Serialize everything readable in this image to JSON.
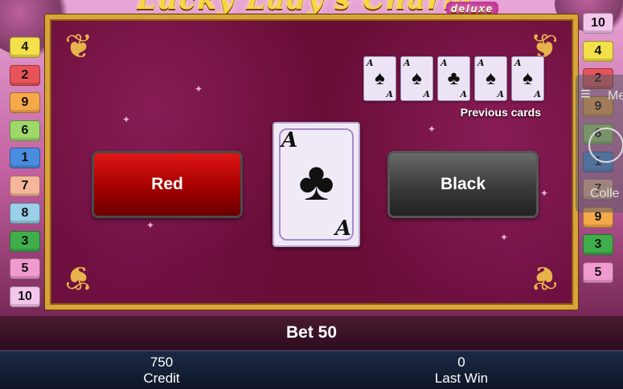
{
  "header": {
    "title_text": "Lucky Lady's Charm",
    "subtitle": "deluxe"
  },
  "left_lines": [
    {
      "n": "4",
      "color": "#f3e04a"
    },
    {
      "n": "2",
      "color": "#e8535a"
    },
    {
      "n": "9",
      "color": "#f6a94a"
    },
    {
      "n": "6",
      "color": "#9fd86a"
    },
    {
      "n": "1",
      "color": "#4a8de0"
    },
    {
      "n": "7",
      "color": "#f5b69a"
    },
    {
      "n": "8",
      "color": "#9ad0e8"
    },
    {
      "n": "3",
      "color": "#3fae4a"
    },
    {
      "n": "5",
      "color": "#f19ad0"
    },
    {
      "n": "10",
      "color": "#f4c6ec"
    }
  ],
  "right_lines": [
    {
      "n": "10",
      "color": "#f4c6ec"
    },
    {
      "n": "4",
      "color": "#f3e04a"
    },
    {
      "n": "2",
      "color": "#e8535a"
    },
    {
      "n": "9",
      "color": "#f6a94a"
    },
    {
      "n": "6",
      "color": "#9fd86a"
    },
    {
      "n": "1",
      "color": "#4a8de0"
    },
    {
      "n": "7",
      "color": "#f5b69a"
    },
    {
      "n": "9",
      "color": "#f6a94a"
    },
    {
      "n": "3",
      "color": "#3fae4a"
    },
    {
      "n": "5",
      "color": "#f19ad0"
    }
  ],
  "gamble": {
    "red_label": "Red",
    "black_label": "Black",
    "current_card": {
      "rank": "A",
      "suit": "♣"
    },
    "previous_label": "Previous cards",
    "previous_cards": [
      {
        "rank": "A",
        "suit": "♠"
      },
      {
        "rank": "A",
        "suit": "♠"
      },
      {
        "rank": "A",
        "suit": "♣"
      },
      {
        "rank": "A",
        "suit": "♠"
      },
      {
        "rank": "A",
        "suit": "♠"
      }
    ]
  },
  "side_panel": {
    "menu_label": "Me",
    "collect_label": "Colle"
  },
  "bet": {
    "label": "Bet 50"
  },
  "status": {
    "credit_value": "750",
    "credit_label": "Credit",
    "lastwin_value": "0",
    "lastwin_label": "Last Win"
  },
  "colors": {
    "frame_gold": "#d9a43a",
    "red_button": "#c40a0a",
    "black_button": "#3a3a3a"
  }
}
